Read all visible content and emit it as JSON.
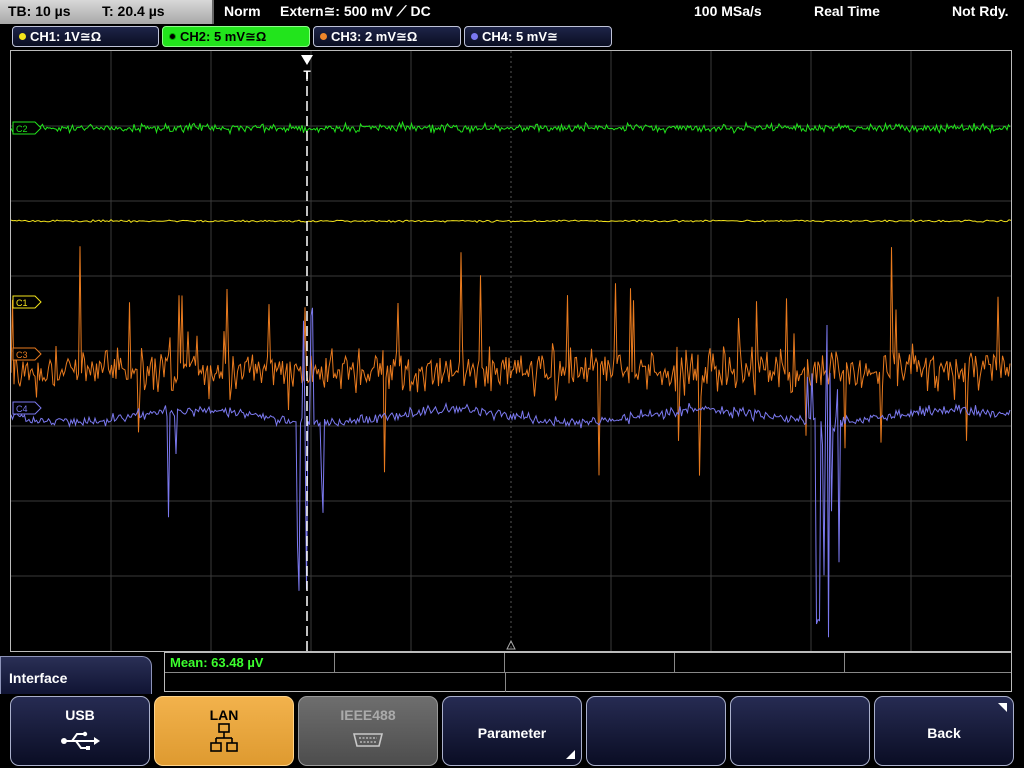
{
  "topbar": {
    "timebase": "TB: 10 µs",
    "trigger_time": "T: 20.4 µs",
    "trigger_mode": "Norm",
    "trigger_source": "Extern≅: 500 mV ⟋ DC",
    "sample_rate": "100 MSa/s",
    "acq_mode": "Real Time",
    "status": "Not Rdy."
  },
  "channels": [
    {
      "label": "CH1: 1V≅Ω",
      "color": "#f5e51c",
      "active": false
    },
    {
      "label": "CH2: 5 mV≅Ω",
      "color": "#22e41c",
      "active": true
    },
    {
      "label": "CH3: 2 mV≅Ω",
      "color": "#f0862a",
      "active": false
    },
    {
      "label": "CH4: 5 mV≅",
      "color": "#7a78f0",
      "active": false
    }
  ],
  "markers": {
    "c2": "C2",
    "c1": "C1",
    "c3": "C3",
    "c4": "C4",
    "trigger": "T"
  },
  "colors": {
    "ch1": "#f5e51c",
    "ch2": "#22e41c",
    "ch3": "#e87a1e",
    "ch4": "#7b79ef",
    "grid": "#3a3a3a"
  },
  "measurement": {
    "mean": "Mean: 63.48 µV"
  },
  "menu": {
    "title": "Interface"
  },
  "softkeys": [
    {
      "label": "USB",
      "icon": "usb-icon",
      "state": "normal"
    },
    {
      "label": "LAN",
      "icon": "lan-icon",
      "state": "active"
    },
    {
      "label": "IEEE488",
      "icon": "gpib-connector-icon",
      "state": "disabled"
    },
    {
      "label": "Parameter",
      "icon": "",
      "state": "normal"
    },
    {
      "label": "",
      "icon": "",
      "state": "normal"
    },
    {
      "label": "",
      "icon": "",
      "state": "normal"
    },
    {
      "label": "Back",
      "icon": "",
      "state": "normal"
    }
  ]
}
